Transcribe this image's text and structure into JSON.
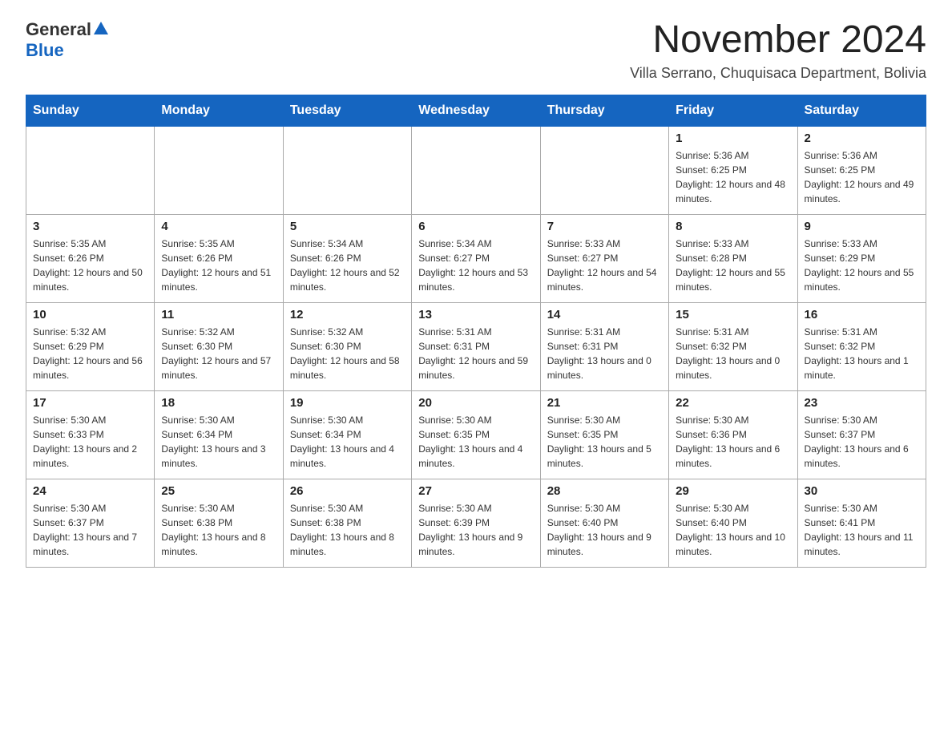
{
  "header": {
    "logo_general": "General",
    "logo_blue": "Blue",
    "month_title": "November 2024",
    "location": "Villa Serrano, Chuquisaca Department, Bolivia"
  },
  "weekdays": [
    "Sunday",
    "Monday",
    "Tuesday",
    "Wednesday",
    "Thursday",
    "Friday",
    "Saturday"
  ],
  "weeks": [
    [
      {
        "day": "",
        "info": ""
      },
      {
        "day": "",
        "info": ""
      },
      {
        "day": "",
        "info": ""
      },
      {
        "day": "",
        "info": ""
      },
      {
        "day": "",
        "info": ""
      },
      {
        "day": "1",
        "info": "Sunrise: 5:36 AM\nSunset: 6:25 PM\nDaylight: 12 hours and 48 minutes."
      },
      {
        "day": "2",
        "info": "Sunrise: 5:36 AM\nSunset: 6:25 PM\nDaylight: 12 hours and 49 minutes."
      }
    ],
    [
      {
        "day": "3",
        "info": "Sunrise: 5:35 AM\nSunset: 6:26 PM\nDaylight: 12 hours and 50 minutes."
      },
      {
        "day": "4",
        "info": "Sunrise: 5:35 AM\nSunset: 6:26 PM\nDaylight: 12 hours and 51 minutes."
      },
      {
        "day": "5",
        "info": "Sunrise: 5:34 AM\nSunset: 6:26 PM\nDaylight: 12 hours and 52 minutes."
      },
      {
        "day": "6",
        "info": "Sunrise: 5:34 AM\nSunset: 6:27 PM\nDaylight: 12 hours and 53 minutes."
      },
      {
        "day": "7",
        "info": "Sunrise: 5:33 AM\nSunset: 6:27 PM\nDaylight: 12 hours and 54 minutes."
      },
      {
        "day": "8",
        "info": "Sunrise: 5:33 AM\nSunset: 6:28 PM\nDaylight: 12 hours and 55 minutes."
      },
      {
        "day": "9",
        "info": "Sunrise: 5:33 AM\nSunset: 6:29 PM\nDaylight: 12 hours and 55 minutes."
      }
    ],
    [
      {
        "day": "10",
        "info": "Sunrise: 5:32 AM\nSunset: 6:29 PM\nDaylight: 12 hours and 56 minutes."
      },
      {
        "day": "11",
        "info": "Sunrise: 5:32 AM\nSunset: 6:30 PM\nDaylight: 12 hours and 57 minutes."
      },
      {
        "day": "12",
        "info": "Sunrise: 5:32 AM\nSunset: 6:30 PM\nDaylight: 12 hours and 58 minutes."
      },
      {
        "day": "13",
        "info": "Sunrise: 5:31 AM\nSunset: 6:31 PM\nDaylight: 12 hours and 59 minutes."
      },
      {
        "day": "14",
        "info": "Sunrise: 5:31 AM\nSunset: 6:31 PM\nDaylight: 13 hours and 0 minutes."
      },
      {
        "day": "15",
        "info": "Sunrise: 5:31 AM\nSunset: 6:32 PM\nDaylight: 13 hours and 0 minutes."
      },
      {
        "day": "16",
        "info": "Sunrise: 5:31 AM\nSunset: 6:32 PM\nDaylight: 13 hours and 1 minute."
      }
    ],
    [
      {
        "day": "17",
        "info": "Sunrise: 5:30 AM\nSunset: 6:33 PM\nDaylight: 13 hours and 2 minutes."
      },
      {
        "day": "18",
        "info": "Sunrise: 5:30 AM\nSunset: 6:34 PM\nDaylight: 13 hours and 3 minutes."
      },
      {
        "day": "19",
        "info": "Sunrise: 5:30 AM\nSunset: 6:34 PM\nDaylight: 13 hours and 4 minutes."
      },
      {
        "day": "20",
        "info": "Sunrise: 5:30 AM\nSunset: 6:35 PM\nDaylight: 13 hours and 4 minutes."
      },
      {
        "day": "21",
        "info": "Sunrise: 5:30 AM\nSunset: 6:35 PM\nDaylight: 13 hours and 5 minutes."
      },
      {
        "day": "22",
        "info": "Sunrise: 5:30 AM\nSunset: 6:36 PM\nDaylight: 13 hours and 6 minutes."
      },
      {
        "day": "23",
        "info": "Sunrise: 5:30 AM\nSunset: 6:37 PM\nDaylight: 13 hours and 6 minutes."
      }
    ],
    [
      {
        "day": "24",
        "info": "Sunrise: 5:30 AM\nSunset: 6:37 PM\nDaylight: 13 hours and 7 minutes."
      },
      {
        "day": "25",
        "info": "Sunrise: 5:30 AM\nSunset: 6:38 PM\nDaylight: 13 hours and 8 minutes."
      },
      {
        "day": "26",
        "info": "Sunrise: 5:30 AM\nSunset: 6:38 PM\nDaylight: 13 hours and 8 minutes."
      },
      {
        "day": "27",
        "info": "Sunrise: 5:30 AM\nSunset: 6:39 PM\nDaylight: 13 hours and 9 minutes."
      },
      {
        "day": "28",
        "info": "Sunrise: 5:30 AM\nSunset: 6:40 PM\nDaylight: 13 hours and 9 minutes."
      },
      {
        "day": "29",
        "info": "Sunrise: 5:30 AM\nSunset: 6:40 PM\nDaylight: 13 hours and 10 minutes."
      },
      {
        "day": "30",
        "info": "Sunrise: 5:30 AM\nSunset: 6:41 PM\nDaylight: 13 hours and 11 minutes."
      }
    ]
  ]
}
